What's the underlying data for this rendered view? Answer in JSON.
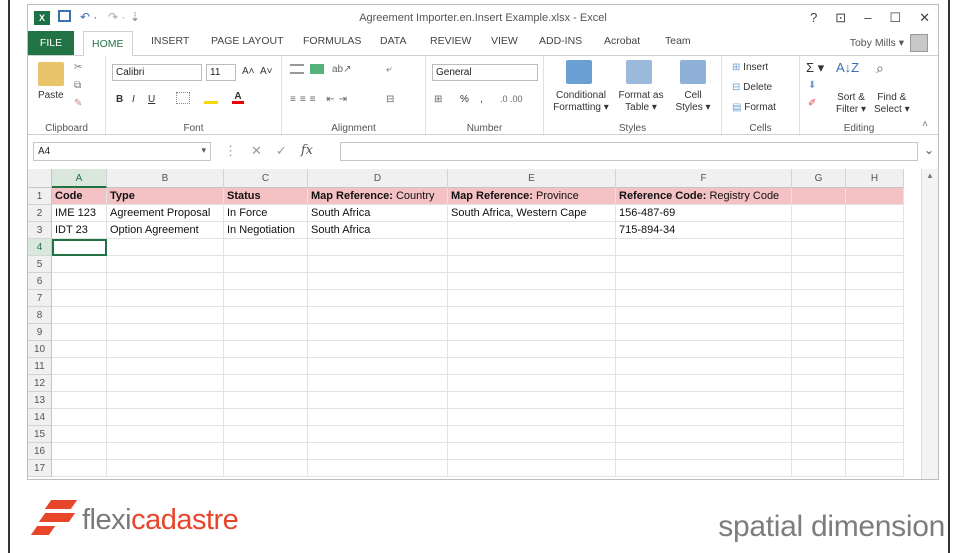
{
  "window": {
    "title": "Agreement Importer.en.Insert Example.xlsx - Excel",
    "controls": [
      "?",
      "⊡",
      "–",
      "☐",
      "✕"
    ]
  },
  "quick_access": {
    "undo": "↶ ·",
    "redo": "↷ ·",
    "customize": "⇣"
  },
  "tabs": [
    "FILE",
    "HOME",
    "INSERT",
    "PAGE LAYOUT",
    "FORMULAS",
    "DATA",
    "REVIEW",
    "VIEW",
    "ADD-INS",
    "Acrobat",
    "Team"
  ],
  "user": {
    "name": "Toby Mills ▾"
  },
  "ribbon": {
    "clipboard": {
      "paste": "Paste",
      "label": "Clipboard"
    },
    "font": {
      "name": "Calibri",
      "size": "11",
      "grow": "A˄",
      "shrink": "A˅",
      "bold": "B",
      "italic": "I",
      "underline": "U",
      "label": "Font"
    },
    "alignment": {
      "label": "Alignment"
    },
    "number": {
      "format": "General",
      "percent": "%",
      "comma": ",",
      "label": "Number"
    },
    "styles": {
      "conditional": "Conditional",
      "conditional2": "Formatting ▾",
      "format_as": "Format as",
      "format_as2": "Table ▾",
      "cell": "Cell",
      "cell2": "Styles ▾",
      "label": "Styles"
    },
    "cells": {
      "insert": "Insert",
      "delete": "Delete",
      "format": "Format",
      "label": "Cells"
    },
    "editing": {
      "sum": "Σ ▾",
      "sort": "Sort &",
      "sort2": "Filter ▾",
      "find": "Find &",
      "find2": "Select ▾",
      "label": "Editing"
    }
  },
  "formula_bar": {
    "name_box": "A4",
    "fx": "fx"
  },
  "columns": [
    "A",
    "B",
    "C",
    "D",
    "E",
    "F",
    "G",
    "H"
  ],
  "rows": [
    "1",
    "2",
    "3",
    "4",
    "5",
    "6",
    "7",
    "8",
    "9",
    "10",
    "11",
    "12",
    "13",
    "14",
    "15",
    "16",
    "17"
  ],
  "header_row": [
    {
      "bold": "Code",
      "rest": ""
    },
    {
      "bold": "Type",
      "rest": ""
    },
    {
      "bold": "Status",
      "rest": ""
    },
    {
      "bold": "Map Reference:",
      "rest": " Country"
    },
    {
      "bold": "Map Reference:",
      "rest": " Province"
    },
    {
      "bold": "Reference Code:",
      "rest": " Registry Code"
    }
  ],
  "data_rows": [
    [
      "IME 123",
      "Agreement Proposal",
      "In Force",
      "South Africa",
      "South Africa, Western Cape",
      "156-487-69"
    ],
    [
      "IDT 23",
      "Option Agreement",
      "In Negotiation",
      "South Africa",
      "",
      "715-894-34"
    ]
  ],
  "footer": {
    "left_logo_a": "flexi",
    "left_logo_b": "cadastre",
    "right_logo": "spatial dimension"
  },
  "colors": {
    "excel_green": "#217346",
    "header_fill": "#f4c2c4",
    "logo_orange": "#e8462a"
  }
}
